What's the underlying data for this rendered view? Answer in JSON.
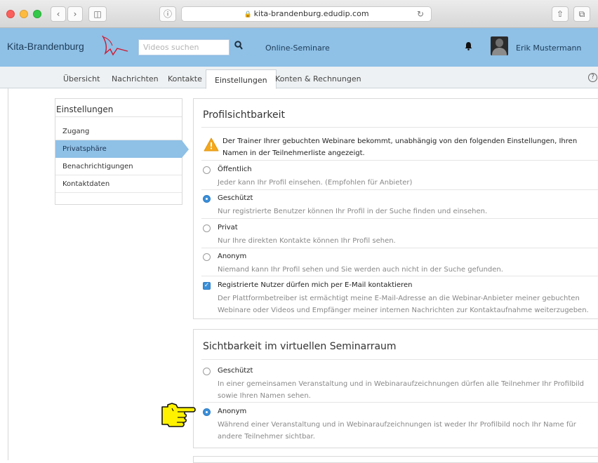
{
  "browser": {
    "url": "kita-brandenburg.edudip.com",
    "back_icon": "chevron-left-icon",
    "forward_icon": "chevron-right-icon",
    "sidebar_icon": "sidebar-icon",
    "info_icon": "info-icon",
    "reload_icon": "reload-icon",
    "share_icon": "share-icon",
    "tabs_icon": "tabs-icon"
  },
  "header": {
    "brand": "Kita-Brandenburg",
    "search_placeholder": "Videos suchen",
    "nav_link": "Online-Seminare",
    "user_name": "Erik Mustermann",
    "bg_color": "#8fc0e6"
  },
  "tabs": [
    {
      "label": "Übersicht"
    },
    {
      "label": "Nachrichten"
    },
    {
      "label": "Kontakte"
    },
    {
      "label": "Einstellungen",
      "active": true
    },
    {
      "label": "Konten & Rechnungen"
    }
  ],
  "sidebar": {
    "title": "Einstellungen",
    "items": [
      {
        "label": "Zugang"
      },
      {
        "label": "Privatsphäre",
        "active": true
      },
      {
        "label": "Benachrichtigungen"
      },
      {
        "label": "Kontaktdaten"
      }
    ]
  },
  "profile": {
    "title": "Profilsichtbarkeit",
    "warning": "Der Trainer Ihrer gebuchten Webinare bekommt, unabhängig von den folgenden Einstellungen, Ihren Namen in der Teilnehmerliste angezeigt.",
    "options": [
      {
        "label": "Öffentlich",
        "desc": "Jeder kann Ihr Profil einsehen. (Empfohlen für Anbieter)",
        "checked": false
      },
      {
        "label": "Geschützt",
        "desc": "Nur registrierte Benutzer können Ihr Profil in der Suche finden und einsehen.",
        "checked": true
      },
      {
        "label": "Privat",
        "desc": "Nur Ihre direkten Kontakte können Ihr Profil sehen.",
        "checked": false
      },
      {
        "label": "Anonym",
        "desc": "Niemand kann Ihr Profil sehen und Sie werden auch nicht in der Suche gefunden.",
        "checked": false
      }
    ],
    "email_checkbox": {
      "label": "Registrierte Nutzer dürfen mich per E-Mail kontaktieren",
      "desc": "Der Plattformbetreiber ist ermächtigt meine E-Mail-Adresse an die Webinar-Anbieter meiner gebuchten Webinare oder Videos und Empfänger meiner internen Nachrichten zur Kontaktaufnahme weiterzugeben.",
      "checked": true
    }
  },
  "seminar": {
    "title": "Sichtbarkeit im virtuellen Seminarraum",
    "options": [
      {
        "label": "Geschützt",
        "desc": "In einer gemeinsamen Veranstaltung und in Webinaraufzeichnungen dürfen alle Teilnehmer Ihr Profilbild sowie Ihren Namen sehen.",
        "checked": false
      },
      {
        "label": "Anonym",
        "desc": "Während einer Veranstaltung und in Webinaraufzeichnungen ist weder Ihr Profilbild noch Ihr Name für andere Teilnehmer sichtbar.",
        "checked": true
      }
    ]
  }
}
